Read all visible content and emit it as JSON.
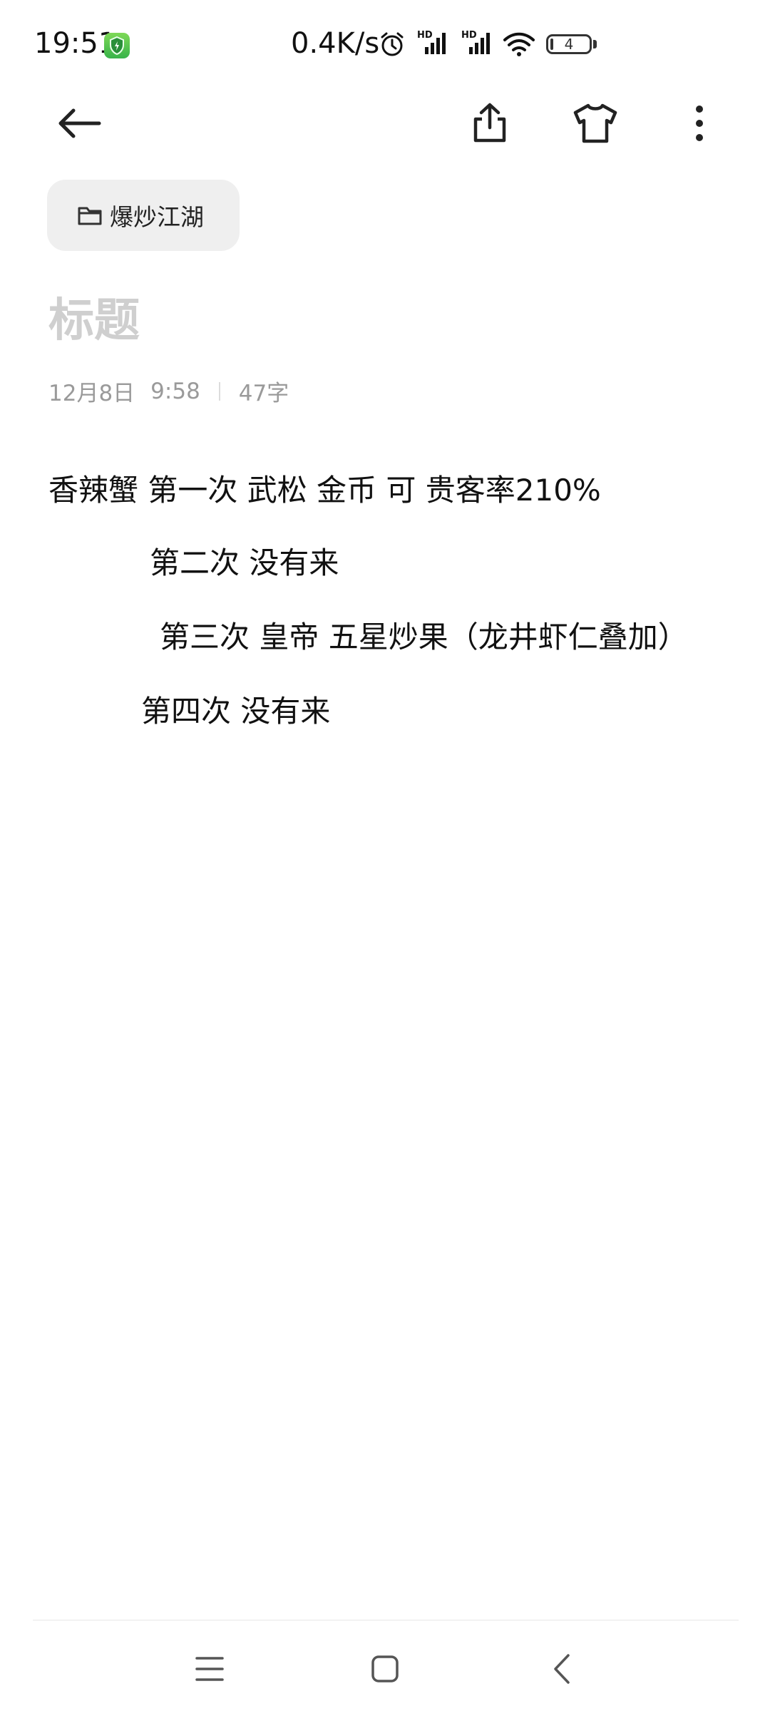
{
  "status_bar": {
    "time": "19:51",
    "network_speed": "0.4K/s",
    "hd1": "HD",
    "hd2": "HD",
    "battery_level": "4",
    "icons": [
      "app-shield-icon",
      "alarm-icon",
      "signal-icon",
      "signal-icon",
      "wifi-icon",
      "battery-icon"
    ]
  },
  "toolbar": {
    "back_icon": "arrow-left-icon",
    "share_icon": "share-icon",
    "theme_icon": "tshirt-icon",
    "more_icon": "more-vertical-icon"
  },
  "folder": {
    "icon": "folder-icon",
    "label": "爆炒江湖"
  },
  "note": {
    "title_placeholder": "标题",
    "date": "12月8日",
    "time": "9:58",
    "char_count": "47字",
    "lines": [
      "香辣蟹 第一次 武松 金币 可 贵客率210%",
      "第二次 没有来",
      "第三次 皇帝 五星炒果（龙井虾仁叠加）",
      "第四次 没有来"
    ]
  },
  "nav_bar": {
    "icons": [
      "menu-icon",
      "home-icon",
      "back-icon"
    ]
  },
  "colors": {
    "background": "#ffffff",
    "chip_background": "#efefef",
    "title_placeholder": "#cfcfcf",
    "meta_text": "#9a9a9a",
    "body_text": "#111111"
  }
}
